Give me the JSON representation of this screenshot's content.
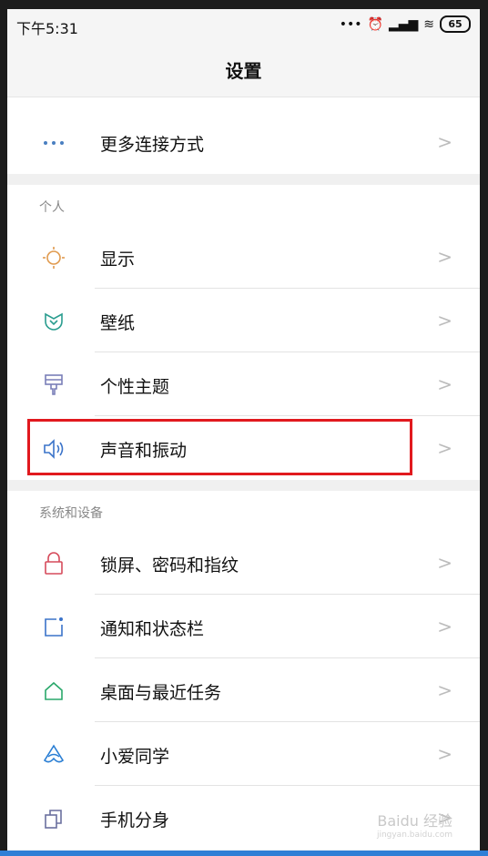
{
  "status": {
    "time": "下午5:31",
    "battery": "65",
    "icons": [
      "dots-icon",
      "alarm-icon",
      "signal-icon",
      "wifi-icon"
    ]
  },
  "header": {
    "title": "设置"
  },
  "rows": {
    "more": {
      "label": "更多连接方式",
      "icon": "more-dots-icon"
    },
    "display": {
      "label": "显示",
      "icon": "sun-icon"
    },
    "wallpaper": {
      "label": "壁纸",
      "icon": "wallpaper-icon"
    },
    "theme": {
      "label": "个性主题",
      "icon": "paintbrush-icon"
    },
    "sound": {
      "label": "声音和振动",
      "icon": "speaker-icon"
    },
    "lock": {
      "label": "锁屏、密码和指纹",
      "icon": "lock-icon"
    },
    "notify": {
      "label": "通知和状态栏",
      "icon": "notification-icon"
    },
    "desktop": {
      "label": "桌面与最近任务",
      "icon": "home-icon"
    },
    "xiaoai": {
      "label": "小爱同学",
      "icon": "xiaoai-icon"
    },
    "dual": {
      "label": "手机分身",
      "icon": "dual-phone-icon"
    }
  },
  "sections": {
    "personal": "个人",
    "system": "系统和设备"
  },
  "chevron": ">",
  "watermark": {
    "brand": "Baidu 经验",
    "url": "jingyan.baidu.com"
  }
}
